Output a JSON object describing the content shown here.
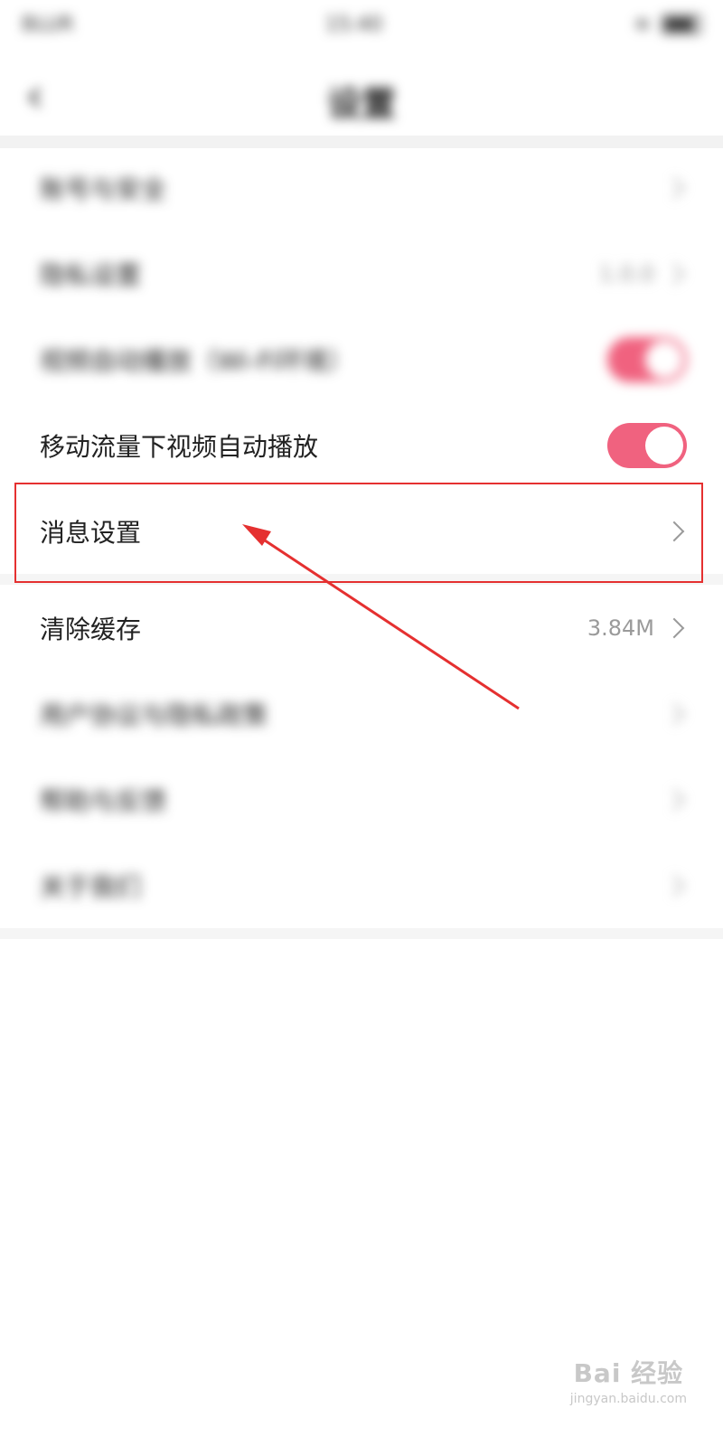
{
  "status_bar": {
    "carrier": "BLUR",
    "time": "15:40"
  },
  "header": {
    "back_icon": "chevron-left-icon",
    "title": "设置"
  },
  "settings": {
    "blur_row_1": "账号与安全",
    "blur_row_2": "隐私设置",
    "blur_row_2_value": "1.0.0",
    "wifi_autoplay": "视频自动播放（Wi-Fi环境）",
    "mobile_autoplay": "移动流量下视频自动播放",
    "message_settings": "消息设置",
    "clear_cache": "清除缓存",
    "cache_size": "3.84M",
    "blur_row_7": "用户协议与隐私政策",
    "blur_row_8": "帮助与反馈",
    "blur_row_9": "关于我们"
  },
  "toggles": {
    "wifi_autoplay_on": true,
    "mobile_autoplay_on": true
  },
  "colors": {
    "toggle_on": "#f0627f",
    "annotation_red": "#e53030"
  },
  "watermark": {
    "main": "Bai 经验",
    "sub": "jingyan.baidu.com"
  }
}
